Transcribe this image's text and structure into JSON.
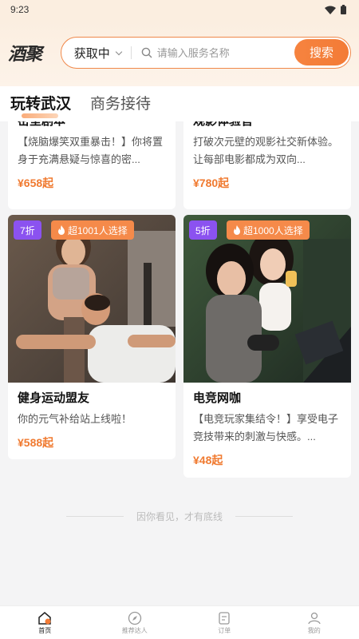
{
  "status": {
    "time": "9:23"
  },
  "header": {
    "logo": "酒聚",
    "location": "获取中",
    "search_placeholder": "请输入服务名称",
    "search_button": "搜索"
  },
  "tabs": [
    {
      "label": "玩转武汉",
      "active": true
    },
    {
      "label": "商务接待",
      "active": false
    }
  ],
  "cards": [
    {
      "title": "密室剧本",
      "desc": "【烧脑爆笑双重暴击！】你将置身于充满悬疑与惊喜的密...",
      "price": "¥658起"
    },
    {
      "title": "观影体验官",
      "desc": "打破次元壁的观影社交新体验。让每部电影都成为双向...",
      "price": "¥780起"
    },
    {
      "title": "健身运动盟友",
      "desc": "你的元气补给站上线啦！",
      "price": "¥588起",
      "discount": "7折",
      "popular": "超1001人选择"
    },
    {
      "title": "电竞网咖",
      "desc": "【电竞玩家集结令！】享受电子竞技带来的刺激与快感。...",
      "price": "¥48起",
      "discount": "5折",
      "popular": "超1000人选择"
    }
  ],
  "footer_note": "因你看见，才有底线",
  "bottom_nav": [
    {
      "label": "首页",
      "icon": "home-icon",
      "active": true
    },
    {
      "label": "推荐达人",
      "icon": "compass-icon",
      "active": false
    },
    {
      "label": "订单",
      "icon": "order-icon",
      "active": false
    },
    {
      "label": "我的",
      "icon": "user-icon",
      "active": false
    }
  ],
  "colors": {
    "accent": "#f37b36",
    "discount_badge": "#8b52f0",
    "popular_badge": "#f58a4a"
  }
}
